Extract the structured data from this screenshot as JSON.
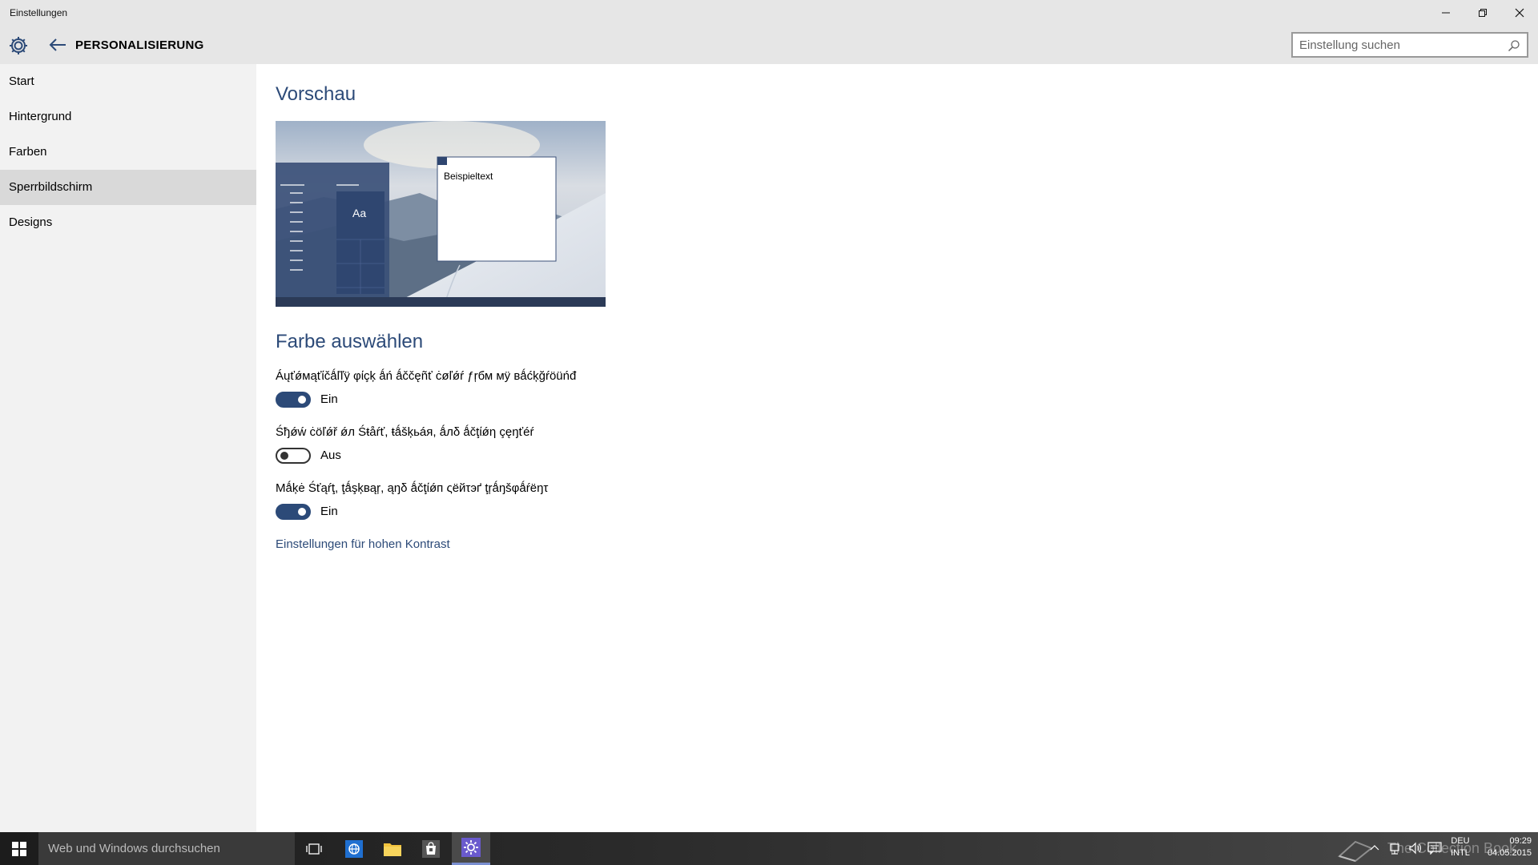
{
  "window": {
    "title": "Einstellungen",
    "minimize_label": "—",
    "maximize_label": "❐",
    "close_label": "✕"
  },
  "header": {
    "page_title": "PERSONALISIERUNG",
    "search_placeholder": "Einstellung suchen"
  },
  "sidebar": {
    "items": [
      {
        "label": "Start"
      },
      {
        "label": "Hintergrund"
      },
      {
        "label": "Farben"
      },
      {
        "label": "Sperrbildschirm",
        "active": true
      },
      {
        "label": "Designs"
      }
    ]
  },
  "main": {
    "preview_title": "Vorschau",
    "preview_sample_text": "Beispieltext",
    "preview_tile_text": "Aa",
    "color_section_title": "Farbe auswählen",
    "settings": [
      {
        "label": "Áųťǿмąťίčǻľľÿ φίçķ ǻń ǻččęñť ċøľǿŕ ƒŗбм мÿ вǻćķğŕöüńđ",
        "state": "Ein",
        "on": true
      },
      {
        "label": "Śђǿẃ ċöľǿř ǿл Śŧåŕť, ŧǻšķьáя, ǻлδ ǻčţίǿη çęŋťéŕ",
        "state": "Aus",
        "on": false
      },
      {
        "label": "Мǻķė Śťąŕţ, ţǻşķвąŗ, ąŋδ ǻčţίǿп ςёйτэґ ţŗǻŋšφǻŕёŋτ",
        "state": "Ein",
        "on": true
      }
    ],
    "high_contrast_link": "Einstellungen für hohen Kontrast"
  },
  "taskbar": {
    "search_placeholder": "Web und Windows durchsuchen",
    "language_top": "DEU",
    "language_bottom": "INTL",
    "time": "09:29",
    "date": "04.05.2015",
    "watermark": "The Collection Book"
  },
  "colors": {
    "accent": "#2c4a78",
    "chrome": "#e6e6e6",
    "sidebar": "#f2f2f2",
    "sidebar_active": "#d9d9d9"
  }
}
